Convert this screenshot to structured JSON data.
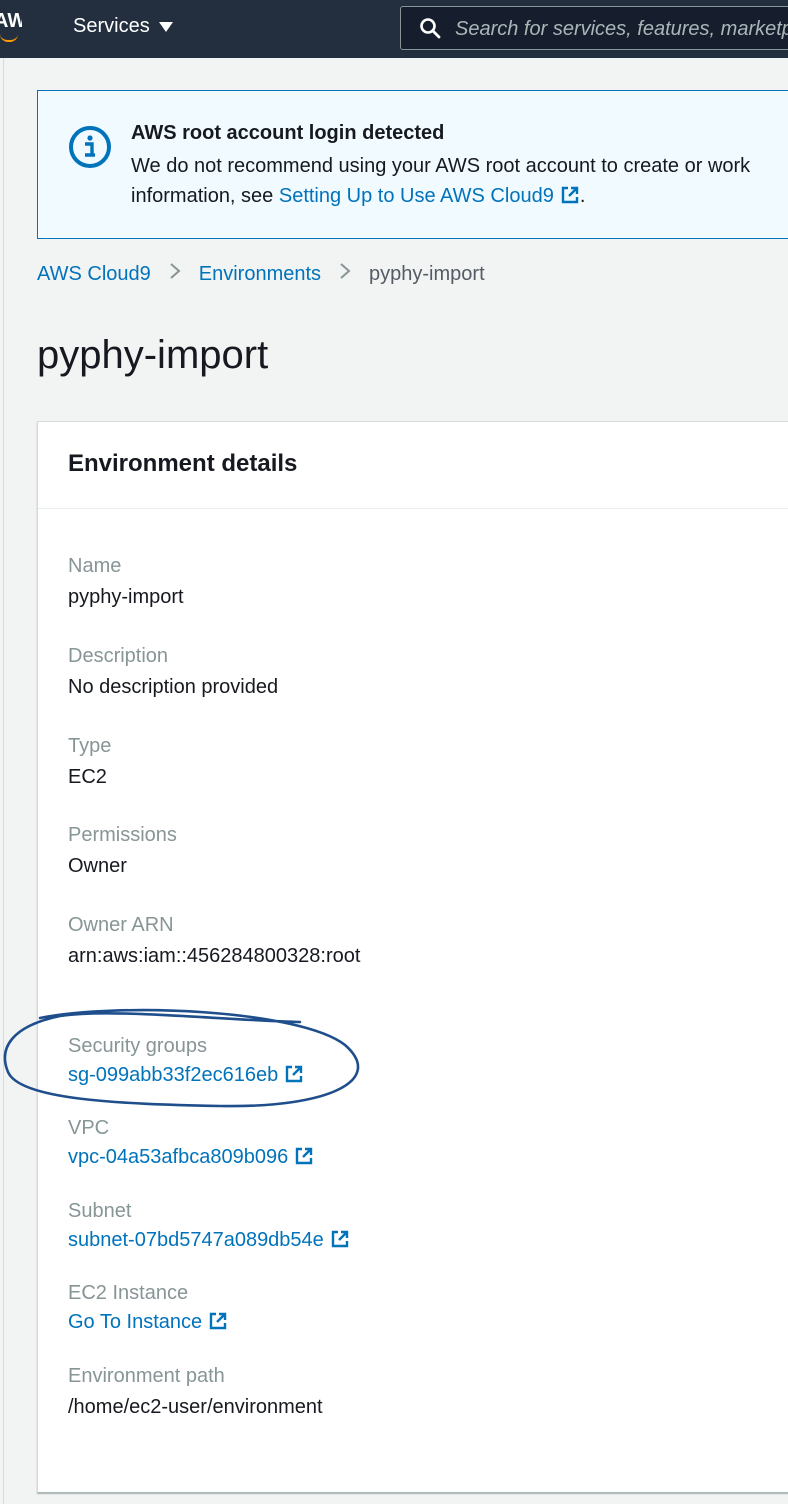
{
  "nav": {
    "logo_text": "AWS",
    "services_label": "Services",
    "search_placeholder": "Search for services, features, marketplace products, and docs"
  },
  "flash": {
    "title": "AWS root account login detected",
    "body_line1": "We do not recommend using your AWS root account to create or work",
    "body_prefix": "information, see ",
    "link_text": "Setting Up to Use AWS Cloud9",
    "body_suffix": "."
  },
  "breadcrumb": {
    "items": [
      {
        "label": "AWS Cloud9"
      },
      {
        "label": "Environments"
      },
      {
        "label": "pyphy-import"
      }
    ]
  },
  "page": {
    "title": "pyphy-import"
  },
  "panel": {
    "title": "Environment details",
    "fields": {
      "name": {
        "label": "Name",
        "value": "pyphy-import"
      },
      "description": {
        "label": "Description",
        "value": "No description provided"
      },
      "type": {
        "label": "Type",
        "value": "EC2"
      },
      "permissions": {
        "label": "Permissions",
        "value": "Owner"
      },
      "owner_arn": {
        "label": "Owner ARN",
        "value": "arn:aws:iam::456284800328:root"
      },
      "security_groups": {
        "label": "Security groups",
        "value": "sg-099abb33f2ec616eb"
      },
      "vpc": {
        "label": "VPC",
        "value": "vpc-04a53afbca809b096"
      },
      "subnet": {
        "label": "Subnet",
        "value": "subnet-07bd5747a089db54e"
      },
      "ec2_instance": {
        "label": "EC2 Instance",
        "value": "Go To Instance"
      },
      "environment_path": {
        "label": "Environment path",
        "value": "/home/ec2-user/environment"
      }
    }
  },
  "colors": {
    "nav_bg": "#232f3e",
    "link": "#0073bb",
    "label": "#879596",
    "annotation": "#1f4e8c"
  },
  "icons": [
    "search-icon",
    "info-icon",
    "external-link-icon",
    "chevron-right-icon",
    "caret-down-icon"
  ]
}
